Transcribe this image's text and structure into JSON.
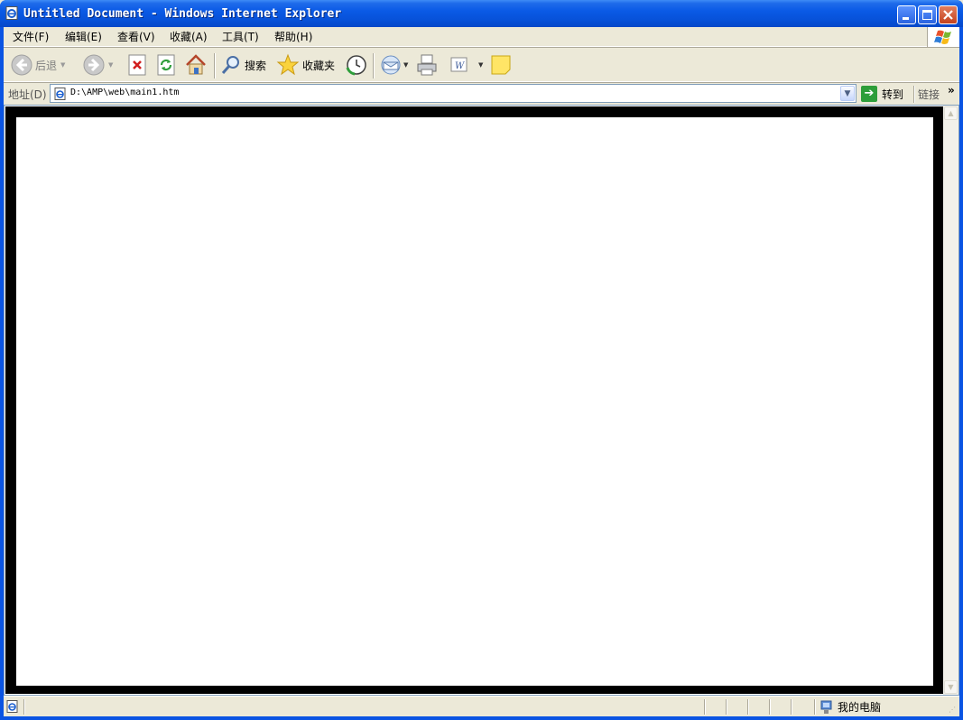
{
  "window": {
    "title": "Untitled Document - Windows Internet Explorer"
  },
  "menu": {
    "items": [
      {
        "label": "文件(F)"
      },
      {
        "label": "编辑(E)"
      },
      {
        "label": "查看(V)"
      },
      {
        "label": "收藏(A)"
      },
      {
        "label": "工具(T)"
      },
      {
        "label": "帮助(H)"
      }
    ]
  },
  "toolbar": {
    "back_label": "后退",
    "search_label": "搜索",
    "favorites_label": "收藏夹"
  },
  "address": {
    "label": "地址(D)",
    "url": "D:\\AMP\\web\\main1.htm",
    "go_label": "转到",
    "links_label": "链接"
  },
  "status": {
    "zone_label": "我的电脑"
  },
  "icons": {
    "window": "ie-page-icon",
    "logo": "windows-flag-icon",
    "back": "back-arrow-icon",
    "forward": "forward-arrow-icon",
    "stop": "stop-icon",
    "refresh": "refresh-icon",
    "home": "home-icon",
    "search": "magnifier-icon",
    "favorites": "star-icon",
    "history": "history-icon",
    "mail": "mail-icon",
    "print": "printer-icon",
    "edit": "word-edit-icon",
    "note": "sticky-note-icon"
  }
}
